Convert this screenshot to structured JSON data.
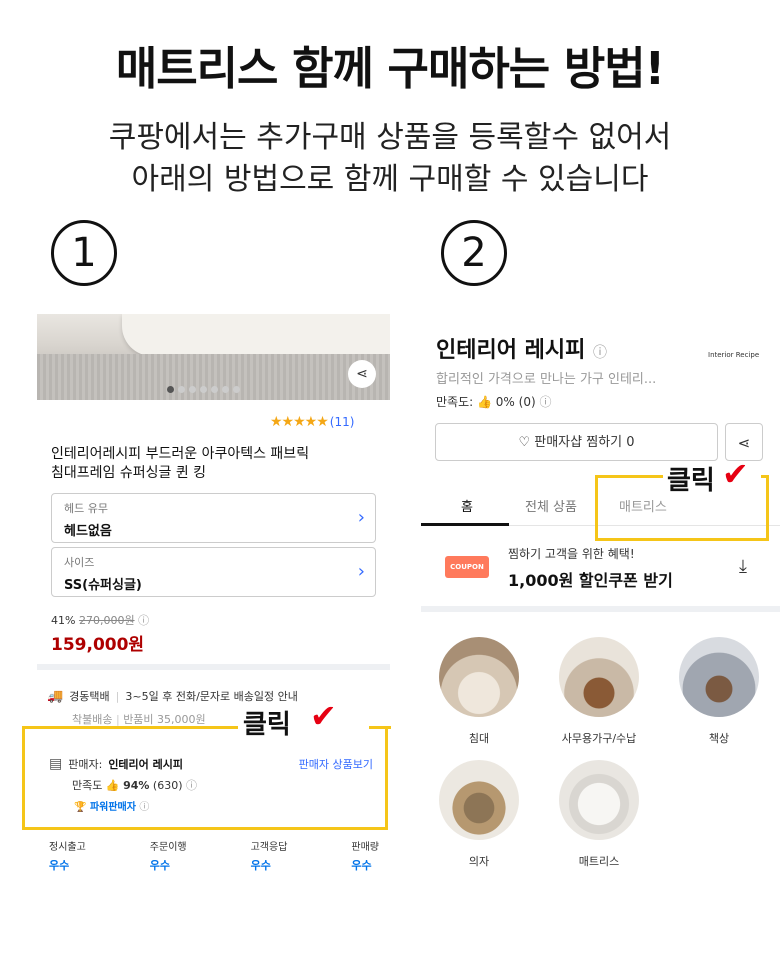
{
  "header": {
    "title": "매트리스 함께 구매하는 방법!",
    "subtitle_line1": "쿠팡에서는 추가구매 상품을 등록할수 없어서",
    "subtitle_line2": "아래의 방법으로 함께 구매할 수 있습니다"
  },
  "steps": {
    "step1": "1",
    "step2": "2"
  },
  "left_panel": {
    "rating_count": "(11)",
    "product_name_line1": "인테리어레시피 부드러운 아쿠아텍스 패브릭",
    "product_name_line2": "침대프레임 슈퍼싱글 퀸 킹",
    "options": [
      {
        "label": "헤드 유무",
        "value": "헤드없음"
      },
      {
        "label": "사이즈",
        "value": "SS(슈퍼싱글)"
      }
    ],
    "discount": "41%",
    "original_price": "270,000원",
    "price": "159,000원",
    "shipping_type": "경동택배",
    "shipping_info": "3~5일 후 전화/문자로 배송일정 안내",
    "shipping_extra1": "착불배송",
    "shipping_extra2": "반품비 35,000원",
    "click_label": "클릭",
    "seller_label": "판매자:",
    "seller_name": "인테리어 레시피",
    "seller_link": "판매자 상품보기",
    "satisfaction_label": "만족도",
    "satisfaction_value": "94%",
    "satisfaction_count": "(630)",
    "power_seller": "파워판매자",
    "stats": [
      {
        "label": "정시출고",
        "value": "우수"
      },
      {
        "label": "주문이행",
        "value": "우수"
      },
      {
        "label": "고객응답",
        "value": "우수"
      },
      {
        "label": "판매량",
        "value": "우수"
      }
    ]
  },
  "right_panel": {
    "store_name": "인테리어 레시피",
    "store_logo": "Interior Recipe",
    "store_desc": "합리적인 가격으로 만나는 가구 인테리...",
    "satisfaction_label": "만족도:",
    "satisfaction_value": "0%",
    "satisfaction_count": "(0)",
    "follow_label": "판매자샵 찜하기 0",
    "click_label": "클릭",
    "tabs": {
      "home": "홈",
      "all": "전체 상품",
      "mattress": "매트리스"
    },
    "coupon_icon": "COUPON",
    "coupon_line1": "찜하기 고객을 위한 혜택!",
    "coupon_line2": "1,000원 할인쿠폰 받기",
    "categories": [
      "침대",
      "사무용가구/수납",
      "책상",
      "의자",
      "매트리스"
    ]
  },
  "colors": {
    "accent_blue": "#346aff",
    "price_red": "#ae0000",
    "highlight_yellow": "#f5c518",
    "check_red": "#e60012"
  }
}
